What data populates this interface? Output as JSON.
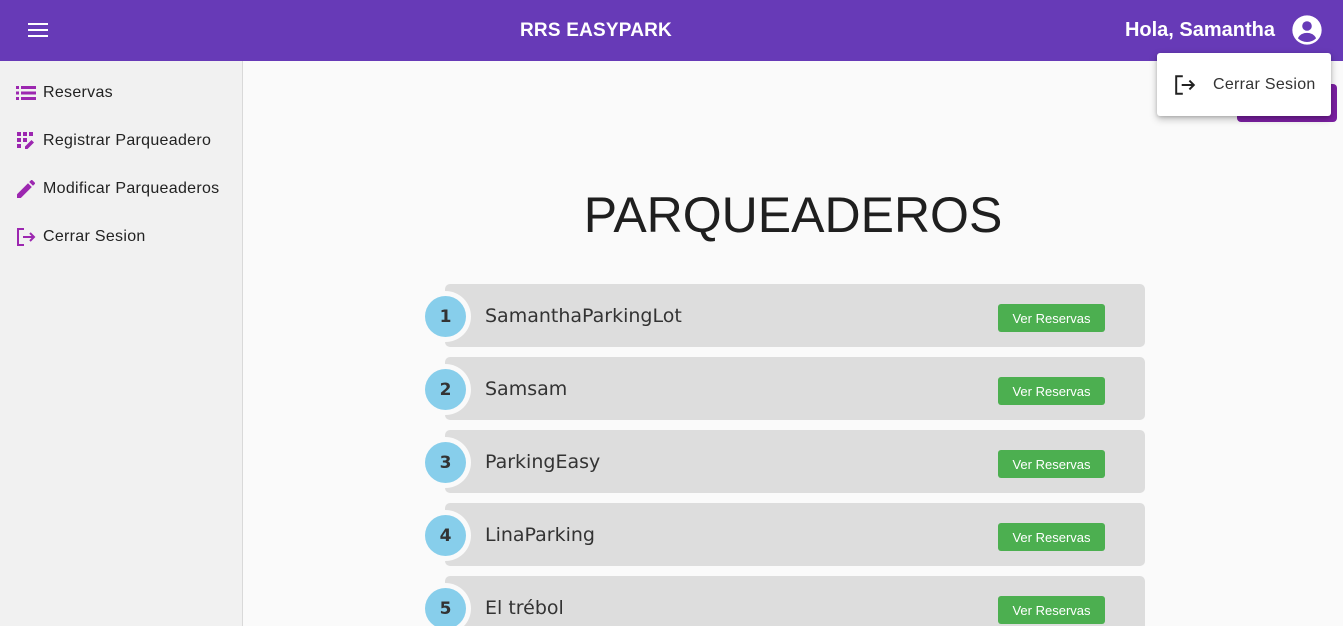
{
  "header": {
    "title": "RRS EASYPARK",
    "greeting": "Hola, Samantha",
    "bg_color": "#673ab7",
    "menu_icon": "hamburger-menu-icon",
    "account_icon": "account-circle-icon"
  },
  "sidebar": {
    "items": [
      {
        "label": "Reservas",
        "icon": "list-icon"
      },
      {
        "label": "Registrar Parqueadero",
        "icon": "grid-edit-icon"
      },
      {
        "label": "Modificar Parqueaderos",
        "icon": "pencil-icon"
      },
      {
        "label": "Cerrar Sesion",
        "icon": "logout-icon"
      }
    ],
    "icon_color": "#9c27b0"
  },
  "main": {
    "title": "PARQUEADEROS",
    "parking_lots": [
      {
        "number": "1",
        "name": "SamanthaParkingLot",
        "button": "Ver Reservas"
      },
      {
        "number": "2",
        "name": "Samsam",
        "button": "Ver Reservas"
      },
      {
        "number": "3",
        "name": "ParkingEasy",
        "button": "Ver Reservas"
      },
      {
        "number": "4",
        "name": "LinaParking",
        "button": "Ver Reservas"
      },
      {
        "number": "5",
        "name": "El trébol",
        "button": "Ver Reservas"
      }
    ],
    "button_color": "#4caf50",
    "badge_color": "#87ceeb"
  },
  "user_menu": {
    "items": [
      {
        "label": "Cerrar Sesion",
        "icon": "logout-icon"
      }
    ]
  }
}
